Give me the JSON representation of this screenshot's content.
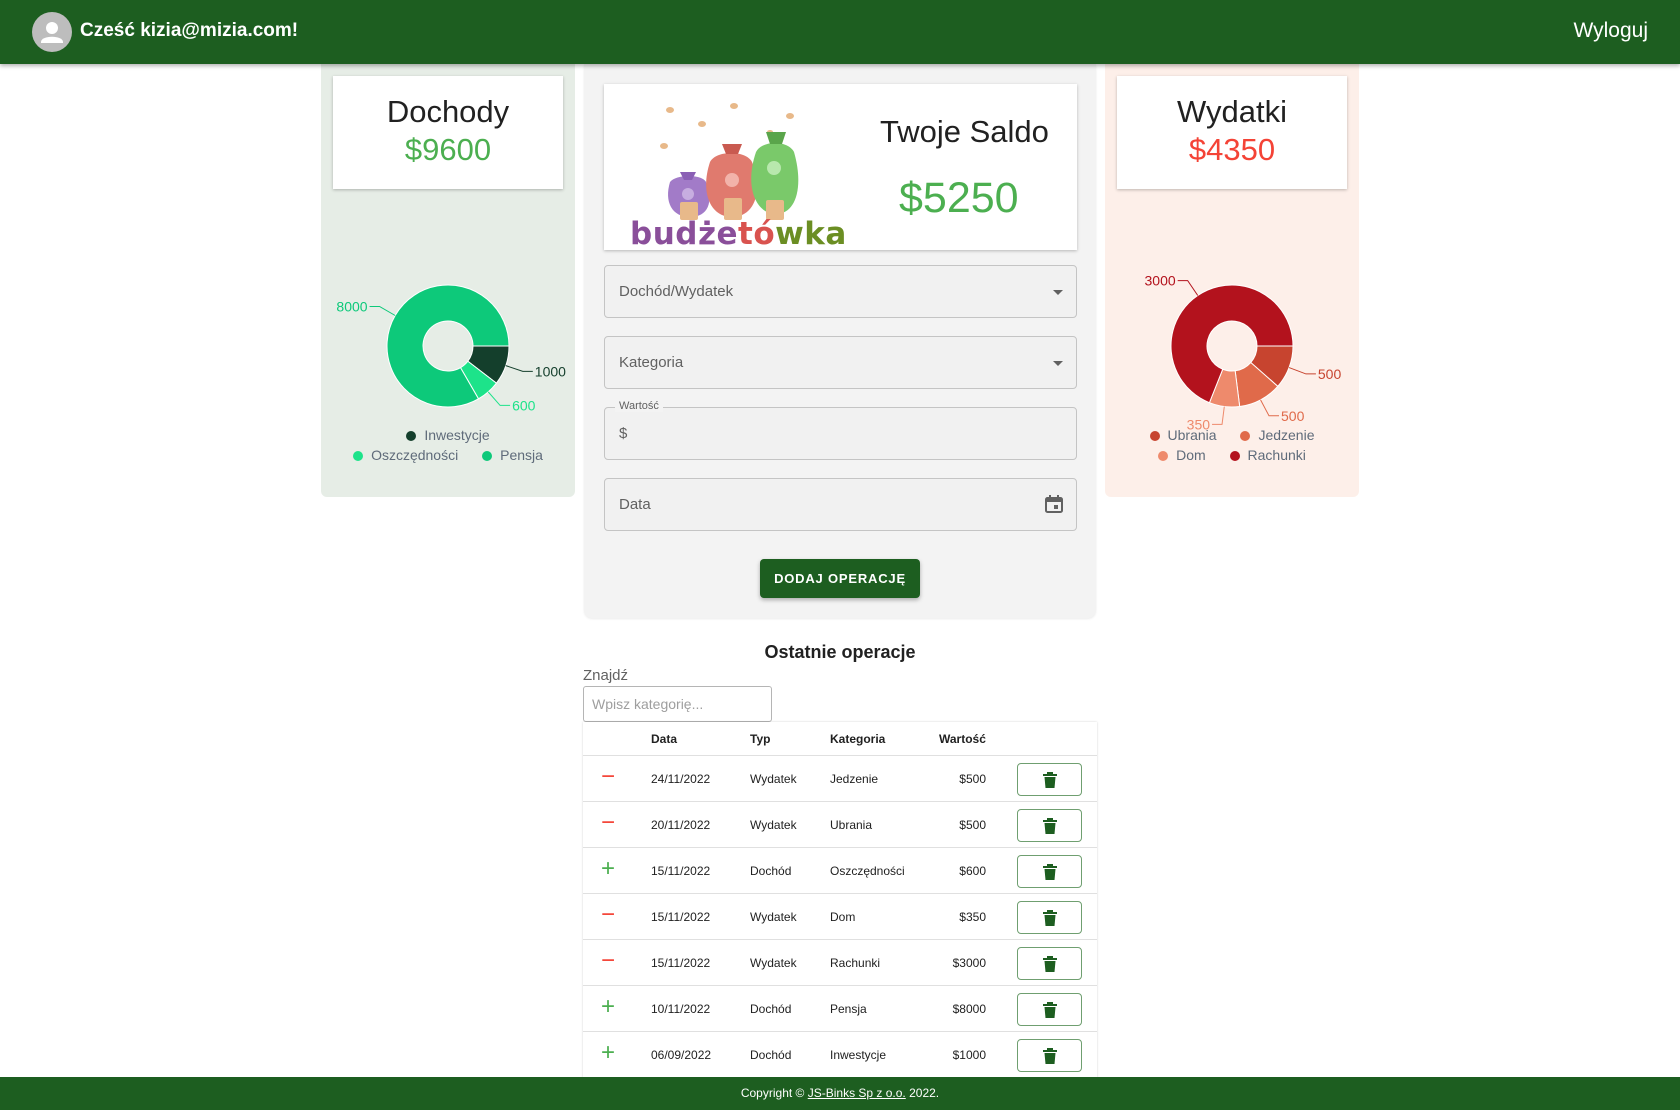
{
  "header": {
    "greeting": "Cześć kizia@mizia.com!",
    "logout_label": "Wyloguj"
  },
  "income": {
    "title": "Dochody",
    "total": "$9600",
    "chart_data": {
      "type": "pie",
      "series": [
        {
          "name": "Inwestycje",
          "value": 1000,
          "color": "#143f2c"
        },
        {
          "name": "Oszczędności",
          "value": 600,
          "color": "#1de38a"
        },
        {
          "name": "Pensja",
          "value": 8000,
          "color": "#0dc97a"
        }
      ],
      "labels": [
        "1000",
        "600",
        "8000"
      ],
      "legend": "bottom"
    },
    "legend_items": [
      "Inwestycje",
      "Oszczędności",
      "Pensja"
    ]
  },
  "expenses": {
    "title": "Wydatki",
    "total": "$4350",
    "chart_data": {
      "type": "pie",
      "series": [
        {
          "name": "Ubrania",
          "value": 500,
          "color": "#c7442f"
        },
        {
          "name": "Jedzenie",
          "value": 500,
          "color": "#e06a4a"
        },
        {
          "name": "Dom",
          "value": 350,
          "color": "#ee8a6c"
        },
        {
          "name": "Rachunki",
          "value": 3000,
          "color": "#b3121d"
        }
      ],
      "labels": [
        "500",
        "500",
        "350",
        "3000"
      ],
      "legend": "bottom"
    },
    "legend_items": [
      "Ubrania",
      "Jedzenie",
      "Dom",
      "Rachunki"
    ]
  },
  "balance": {
    "title": "Twoje Saldo",
    "value": "$5250",
    "logo_part1": "budże",
    "logo_part2": "tó",
    "logo_part3": "wka"
  },
  "form": {
    "type_placeholder": "Dochód/Wydatek",
    "category_placeholder": "Kategoria",
    "value_label": "Wartość",
    "value_prefix": "$",
    "date_placeholder": "Data",
    "submit_label": "DODAJ OPERACJĘ"
  },
  "operations": {
    "title": "Ostatnie operacje",
    "search_label": "Znajdź",
    "search_placeholder": "Wpisz kategorię...",
    "columns": [
      "Data",
      "Typ",
      "Kategoria",
      "Wartość"
    ],
    "rows": [
      {
        "sign": "−",
        "kind": "minus",
        "date": "24/11/2022",
        "type": "Wydatek",
        "category": "Jedzenie",
        "value": "$500"
      },
      {
        "sign": "−",
        "kind": "minus",
        "date": "20/11/2022",
        "type": "Wydatek",
        "category": "Ubrania",
        "value": "$500"
      },
      {
        "sign": "+",
        "kind": "plus",
        "date": "15/11/2022",
        "type": "Dochód",
        "category": "Oszczędności",
        "value": "$600"
      },
      {
        "sign": "−",
        "kind": "minus",
        "date": "15/11/2022",
        "type": "Wydatek",
        "category": "Dom",
        "value": "$350"
      },
      {
        "sign": "−",
        "kind": "minus",
        "date": "15/11/2022",
        "type": "Wydatek",
        "category": "Rachunki",
        "value": "$3000"
      },
      {
        "sign": "+",
        "kind": "plus",
        "date": "10/11/2022",
        "type": "Dochód",
        "category": "Pensja",
        "value": "$8000"
      },
      {
        "sign": "+",
        "kind": "plus",
        "date": "06/09/2022",
        "type": "Dochód",
        "category": "Inwestycje",
        "value": "$1000"
      }
    ]
  },
  "footer": {
    "prefix": "Copyright © ",
    "link": "JS-Binks Sp z o.o.",
    "suffix": " 2022."
  }
}
